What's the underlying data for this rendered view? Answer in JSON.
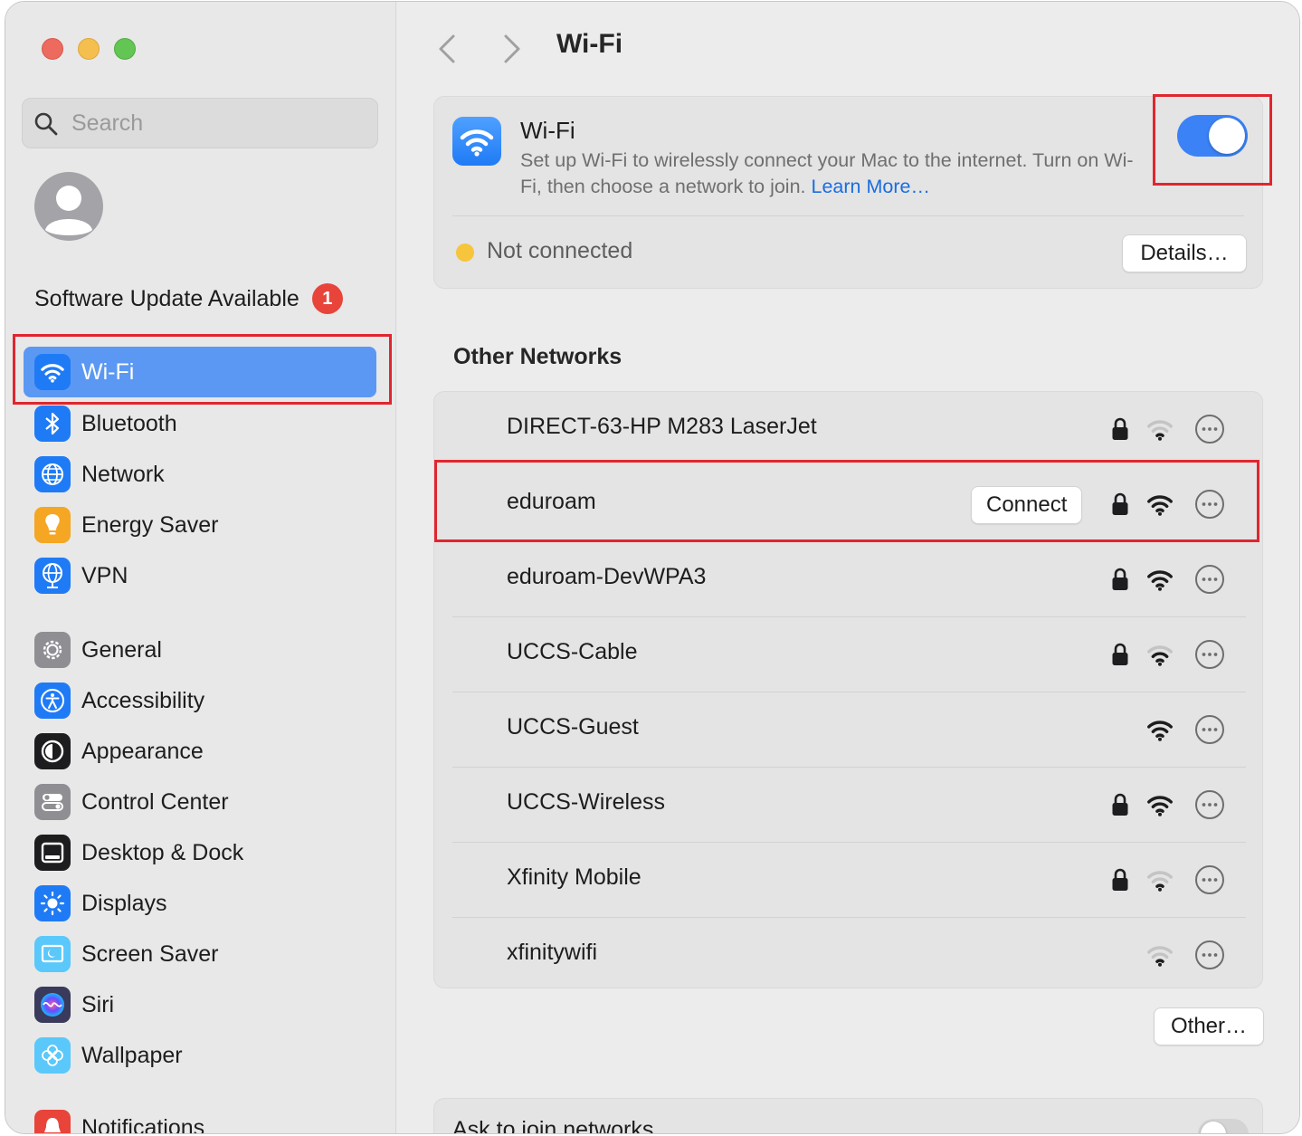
{
  "sidebar": {
    "search_placeholder": "Search",
    "software_update": {
      "label": "Software Update Available",
      "badge": "1"
    },
    "items": [
      {
        "id": "wifi",
        "label": "Wi-Fi",
        "icon": "wifi-icon",
        "color": "#1f7bf5",
        "active": true
      },
      {
        "id": "bluetooth",
        "label": "Bluetooth",
        "icon": "bluetooth-icon",
        "color": "#1f7bf5"
      },
      {
        "id": "network",
        "label": "Network",
        "icon": "globe-icon",
        "color": "#1f7bf5"
      },
      {
        "id": "energy",
        "label": "Energy Saver",
        "icon": "lightbulb-icon",
        "color": "#f5a623"
      },
      {
        "id": "vpn",
        "label": "VPN",
        "icon": "vpn-globe-icon",
        "color": "#1f7bf5"
      },
      {
        "id": "general",
        "label": "General",
        "icon": "gear-icon",
        "color": "#8e8e93"
      },
      {
        "id": "accessibility",
        "label": "Accessibility",
        "icon": "accessibility-icon",
        "color": "#1f7bf5"
      },
      {
        "id": "appearance",
        "label": "Appearance",
        "icon": "appearance-icon",
        "color": "#1d1d1f"
      },
      {
        "id": "control-center",
        "label": "Control Center",
        "icon": "switches-icon",
        "color": "#8e8e93"
      },
      {
        "id": "desktop-dock",
        "label": "Desktop & Dock",
        "icon": "dock-icon",
        "color": "#1d1d1f"
      },
      {
        "id": "displays",
        "label": "Displays",
        "icon": "sun-icon",
        "color": "#1f7bf5"
      },
      {
        "id": "screen-saver",
        "label": "Screen Saver",
        "icon": "screen-saver-icon",
        "color": "#5ac8fa"
      },
      {
        "id": "siri",
        "label": "Siri",
        "icon": "siri-icon",
        "color": "#3a3a5c"
      },
      {
        "id": "wallpaper",
        "label": "Wallpaper",
        "icon": "flower-icon",
        "color": "#5ac8fa"
      },
      {
        "id": "notifications",
        "label": "Notifications",
        "icon": "bell-icon",
        "color": "#e8443a"
      }
    ]
  },
  "header": {
    "title": "Wi-Fi"
  },
  "wifi_card": {
    "title": "Wi-Fi",
    "description": "Set up Wi-Fi to wirelessly connect your Mac to the internet. Turn on Wi-Fi, then choose a network to join.",
    "learn_more": "Learn More…",
    "enabled": true,
    "status": "Not connected",
    "details_button": "Details…"
  },
  "other_networks": {
    "title": "Other Networks",
    "networks": [
      {
        "name": "DIRECT-63-HP M283 LaserJet",
        "locked": true,
        "signal": "weak"
      },
      {
        "name": "eduroam",
        "locked": true,
        "signal": "strong",
        "connect_label": "Connect"
      },
      {
        "name": "eduroam-DevWPA3",
        "locked": true,
        "signal": "strong"
      },
      {
        "name": "UCCS-Cable",
        "locked": true,
        "signal": "medium"
      },
      {
        "name": "UCCS-Guest",
        "locked": false,
        "signal": "strong"
      },
      {
        "name": "UCCS-Wireless",
        "locked": true,
        "signal": "strong"
      },
      {
        "name": "Xfinity Mobile",
        "locked": true,
        "signal": "weak"
      },
      {
        "name": "xfinitywifi",
        "locked": false,
        "signal": "weak"
      }
    ],
    "other_button": "Other…"
  },
  "ask_to_join": {
    "label": "Ask to join networks",
    "enabled": false
  },
  "colors": {
    "accent": "#3a82f6",
    "highlight": "#e0262f",
    "status_dot": "#f6c53c"
  }
}
